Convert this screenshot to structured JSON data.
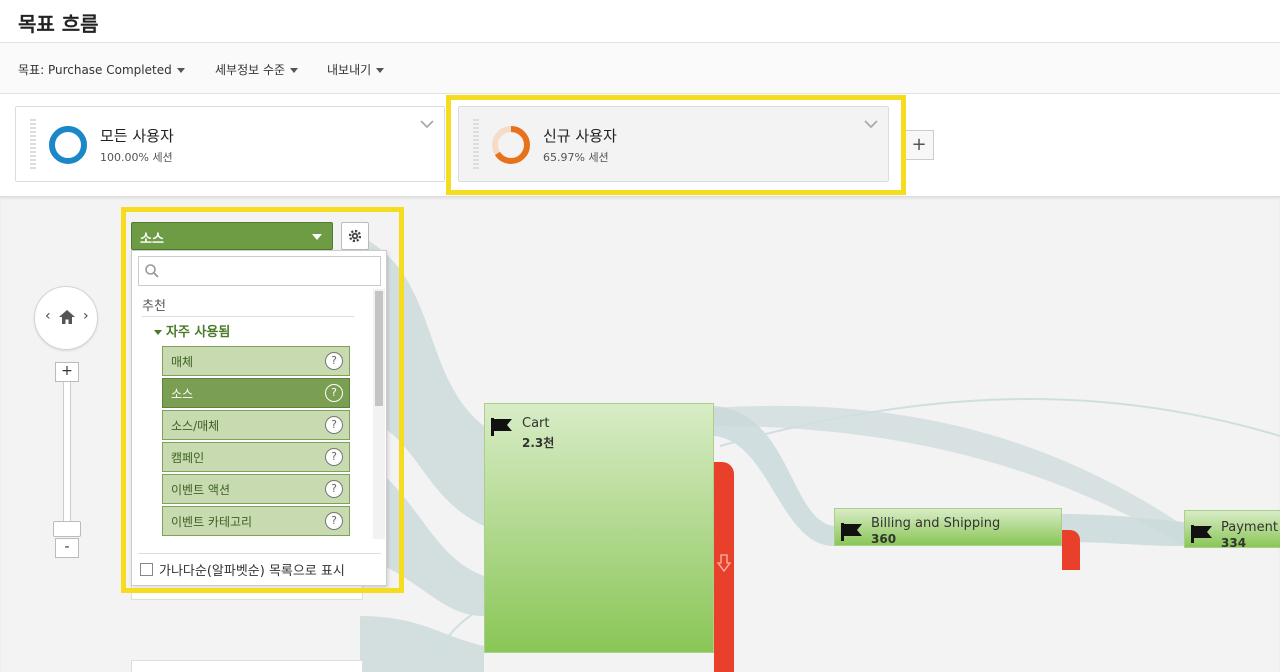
{
  "page": {
    "title": "목표 흐름"
  },
  "toolbar": {
    "goal_label": "목표: Purchase Completed",
    "detail_label": "세부정보 수준",
    "export_label": "내보내기"
  },
  "segments": [
    {
      "name": "모든 사용자",
      "pct": "100.00% 세션",
      "color": "#1a87c9",
      "share": 1.0
    },
    {
      "name": "신규 사용자",
      "pct": "65.97% 세션",
      "color": "#e8711c",
      "share": 0.6597
    }
  ],
  "add_segment_label": "+",
  "dimension": {
    "selected": "소스",
    "search_placeholder": "",
    "section": "추천",
    "group": "자주 사용됨",
    "items": [
      "매체",
      "소스",
      "소스/매체",
      "캠페인",
      "이벤트 액션",
      "이벤트 카테고리"
    ],
    "help_glyph": "?",
    "checkbox_label": "가나다순(알파벳순) 목록으로 표시"
  },
  "nav": {
    "left": "‹",
    "right": "›",
    "zoom_in": "+",
    "zoom_out": "-"
  },
  "funnel": {
    "colors": {
      "node": "#8ac657",
      "drop": "#e8402b",
      "flow": "#c9d9da"
    },
    "stages": [
      {
        "name": "Cart",
        "count": "2.3천"
      },
      {
        "name": "Billing and Shipping",
        "count": "360"
      },
      {
        "name": "Payment",
        "count": "334"
      }
    ]
  }
}
